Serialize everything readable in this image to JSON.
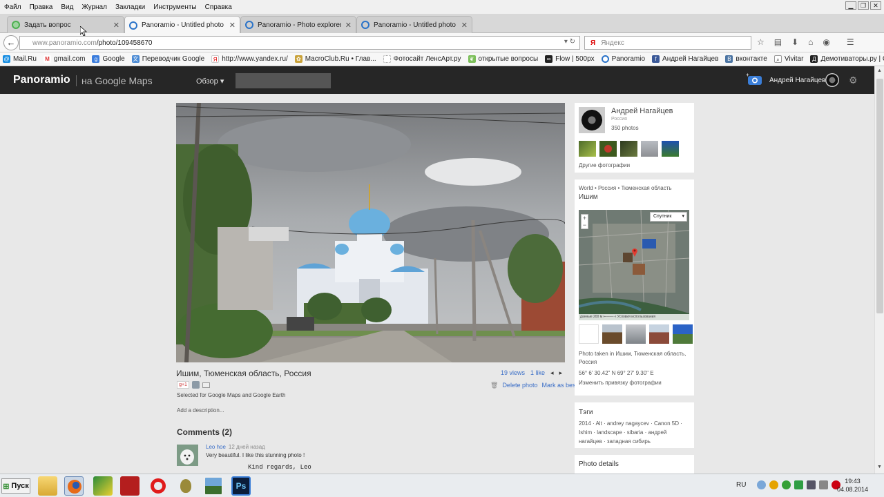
{
  "menubar": {
    "items": [
      "Файл",
      "Правка",
      "Вид",
      "Журнал",
      "Закладки",
      "Инструменты",
      "Справка"
    ]
  },
  "tabs": [
    {
      "label": "Задать вопрос",
      "active": false
    },
    {
      "label": "Panoramio - Untitled photo",
      "active": true
    },
    {
      "label": "Panoramio - Photo explorer",
      "active": false
    },
    {
      "label": "Panoramio - Untitled photo",
      "active": false
    }
  ],
  "navbar": {
    "url_host": "www.panoramio.com",
    "url_path": "/photo/109458670",
    "search_placeholder": "Яндекс"
  },
  "bookmarks": [
    "Mail.Ru",
    "gmail.com",
    "Google",
    "Переводчик Google",
    "http://www.yandex.ru/",
    "MacroClub.Ru • Глав...",
    "Фотосайт ЛенсАрт.ру",
    "открытые вопросы",
    "Flow | 500px",
    "Panoramio",
    "Андрей Нагайцев",
    "вконтакте",
    "Vivitar",
    "Демотиваторы.ру | С..."
  ],
  "header": {
    "logo": "Panoramio",
    "logo_sub": "на Google Maps",
    "browse": "Обзор ▾",
    "username": "Андрей Нагайцев"
  },
  "photo": {
    "location": "Ишим, Тюменская область, Россия",
    "views": "19 views",
    "likes": "1 like",
    "delete": "Delete photo",
    "mark_best": "Mark as best",
    "selected_text": "Selected for Google Maps and Google Earth",
    "add_description": "Add a description...",
    "gplus": "g+1"
  },
  "comments": {
    "title": "Comments (2)",
    "items": [
      {
        "author": "Leo hoe",
        "time": "12 дней назад",
        "text": "Very beautiful. I like this stunning photo !",
        "signature": "Kind regards, Leo"
      }
    ]
  },
  "author": {
    "name": "Андрей Нагайцев",
    "country": "Россия",
    "count": "350 photos",
    "other": "Другие фотографии"
  },
  "place": {
    "crumbs": "World • Россия • Тюменская область",
    "name": "Ишим",
    "map_type": "Спутник",
    "map_footer": "данные   200 м ⊢——⊣   Условия использования",
    "taken": "Photo taken in Ишим, Тюменская область, Россия",
    "coords": "56° 6' 30.42\" N  69° 27' 9.30\" E",
    "change": "Изменить привязку фотографии"
  },
  "tags": {
    "title": "Тэги",
    "list": "2014 · Alt · andrey nagaycev · Canon 5D · Ishim · landscape · sibaria · андрей нагайцев · западная сибирь"
  },
  "details": {
    "title": "Photo details"
  },
  "taskbar": {
    "start": "Пуск",
    "lang": "RU",
    "time": "19:43",
    "date": "04.08.2014"
  },
  "colors": {
    "header_bg": "#262626",
    "link": "#3a6ec7",
    "page_bg": "#e8e8e8"
  }
}
